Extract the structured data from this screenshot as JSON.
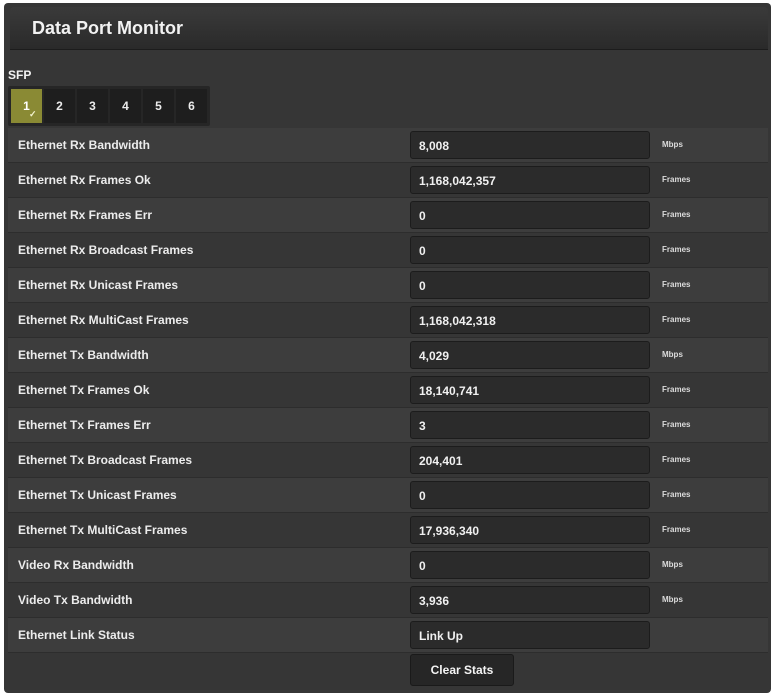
{
  "header": {
    "title": "Data Port Monitor"
  },
  "sfp": {
    "label": "SFP",
    "tabs": [
      {
        "label": "1",
        "active": true
      },
      {
        "label": "2",
        "active": false
      },
      {
        "label": "3",
        "active": false
      },
      {
        "label": "4",
        "active": false
      },
      {
        "label": "5",
        "active": false
      },
      {
        "label": "6",
        "active": false
      }
    ]
  },
  "stats": [
    {
      "label": "Ethernet Rx Bandwidth",
      "value": "8,008",
      "unit": "Mbps"
    },
    {
      "label": "Ethernet Rx Frames Ok",
      "value": "1,168,042,357",
      "unit": "Frames"
    },
    {
      "label": "Ethernet Rx Frames Err",
      "value": "0",
      "unit": "Frames"
    },
    {
      "label": "Ethernet Rx Broadcast Frames",
      "value": "0",
      "unit": "Frames"
    },
    {
      "label": "Ethernet Rx Unicast Frames",
      "value": "0",
      "unit": "Frames"
    },
    {
      "label": "Ethernet Rx MultiCast Frames",
      "value": "1,168,042,318",
      "unit": "Frames"
    },
    {
      "label": "Ethernet Tx Bandwidth",
      "value": "4,029",
      "unit": "Mbps"
    },
    {
      "label": "Ethernet Tx Frames Ok",
      "value": "18,140,741",
      "unit": "Frames"
    },
    {
      "label": "Ethernet Tx Frames Err",
      "value": "3",
      "unit": "Frames"
    },
    {
      "label": "Ethernet Tx Broadcast Frames",
      "value": "204,401",
      "unit": "Frames"
    },
    {
      "label": "Ethernet Tx Unicast Frames",
      "value": "0",
      "unit": "Frames"
    },
    {
      "label": "Ethernet Tx MultiCast Frames",
      "value": "17,936,340",
      "unit": "Frames"
    },
    {
      "label": "Video Rx Bandwidth",
      "value": "0",
      "unit": "Mbps"
    },
    {
      "label": "Video Tx Bandwidth",
      "value": "3,936",
      "unit": "Mbps"
    },
    {
      "label": "Ethernet Link Status",
      "value": "Link Up",
      "unit": ""
    }
  ],
  "actions": {
    "clear_label": "Clear Stats"
  },
  "colors": {
    "panel_bg": "#363636",
    "active_tab": "#8a8a34",
    "field_bg": "#2b2b2b"
  },
  "icons": {
    "active_tab_marker": "check-mark-icon"
  }
}
